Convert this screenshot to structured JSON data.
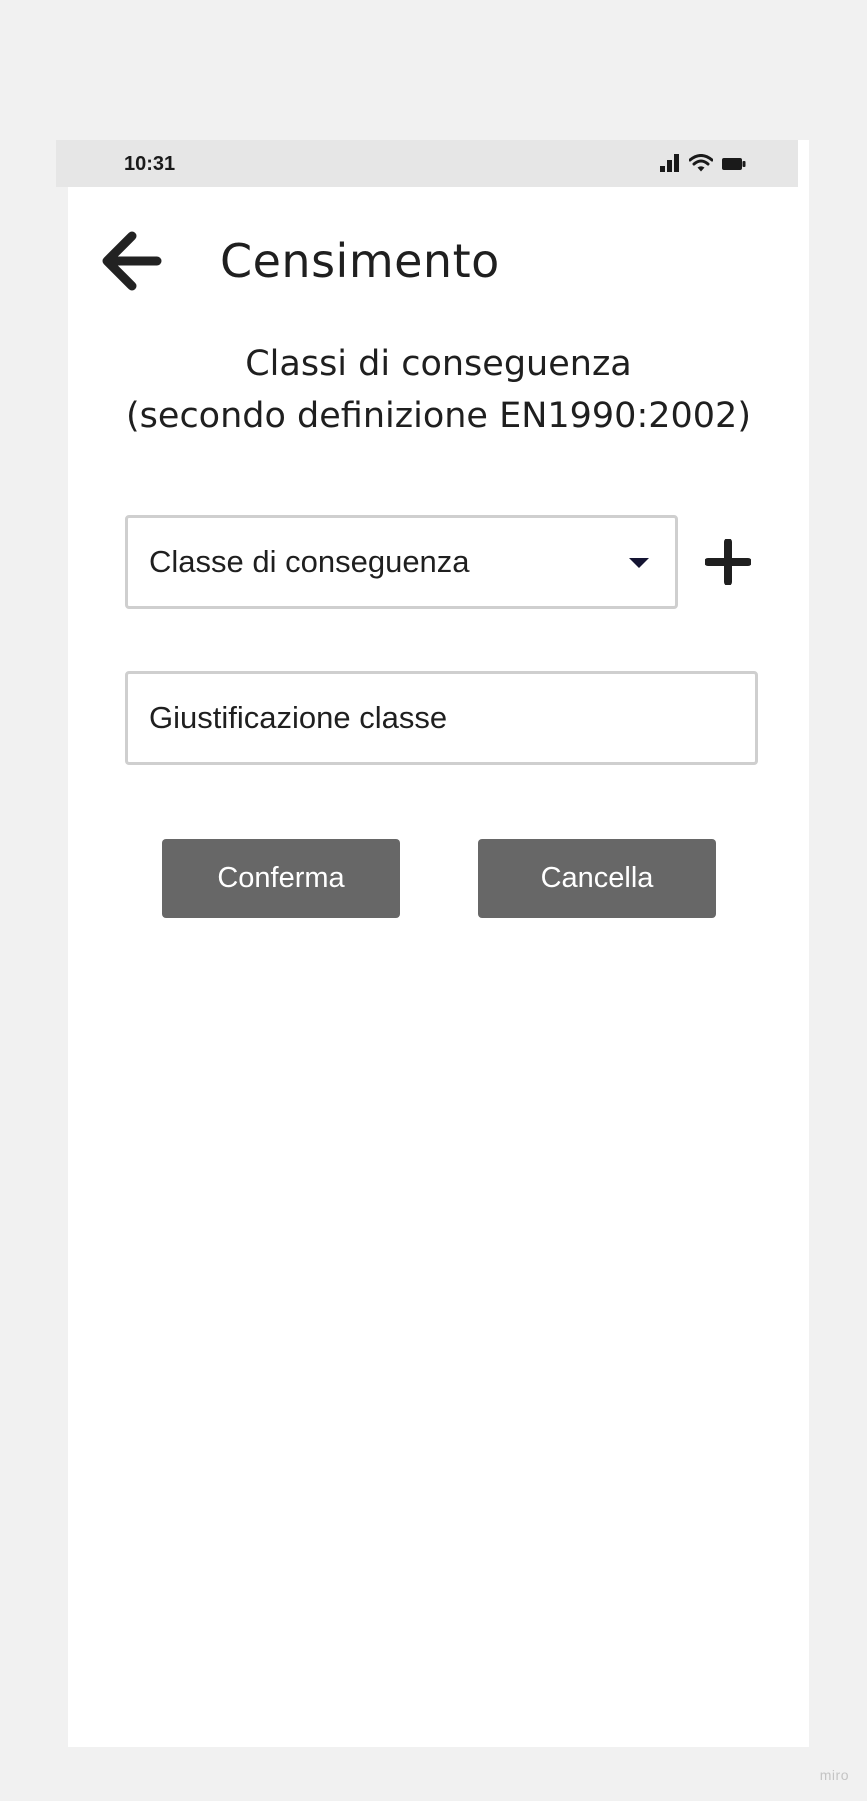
{
  "status_bar": {
    "time": "10:31",
    "icons": [
      "signal-icon",
      "wifi-icon",
      "battery-icon"
    ]
  },
  "header": {
    "back_icon": "arrow-left-icon",
    "title": "Censimento"
  },
  "section": {
    "title_line1": "Classi di conseguenza",
    "title_line2": "(secondo definizione EN1990:2002)"
  },
  "form": {
    "class_select": {
      "value": "Classe di conseguenza",
      "icon": "chevron-down-icon"
    },
    "add_icon": "plus-icon",
    "justification": {
      "placeholder": "Giustificazione classe"
    }
  },
  "actions": {
    "confirm_label": "Conferma",
    "cancel_label": "Cancella"
  },
  "watermark": "miro",
  "colors": {
    "background": "#f1f1f1",
    "status_bar": "#e6e6e6",
    "button": "#676767",
    "field_border": "#cfcfcf",
    "text": "#1f1f1f"
  }
}
